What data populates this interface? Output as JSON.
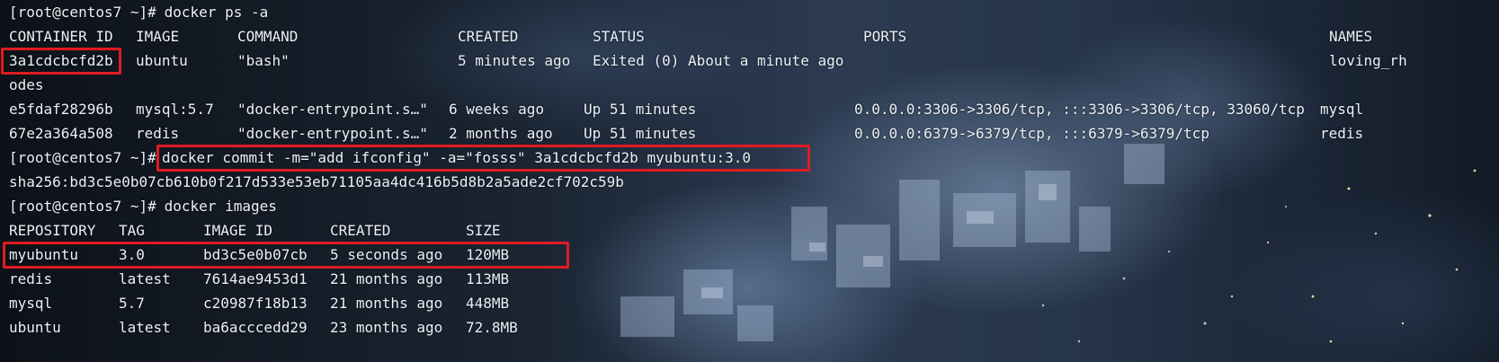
{
  "terminal": {
    "prompt": "[root@centos7 ~]#",
    "cmd1": " docker ps -a",
    "ps_headers": {
      "id": "CONTAINER ID",
      "image": "IMAGE",
      "command": "COMMAND",
      "created": "CREATED",
      "status": "STATUS",
      "ports": "PORTS",
      "names": "NAMES"
    },
    "ps_rows": [
      {
        "id": "3a1cdcbcfd2b",
        "image": "ubuntu",
        "command": "\"bash\"",
        "created": "5 minutes ago",
        "status": "Exited (0) About a minute ago",
        "ports": "",
        "names": "loving_rh",
        "wrap": "odes"
      },
      {
        "id": "e5fdaf28296b",
        "image": "mysql:5.7",
        "command": "\"docker-entrypoint.s…\"",
        "created": "6 weeks ago",
        "status": "Up 51 minutes",
        "ports": "0.0.0.0:3306->3306/tcp, :::3306->3306/tcp, 33060/tcp",
        "names": "mysql"
      },
      {
        "id": "67e2a364a508",
        "image": "redis",
        "command": "\"docker-entrypoint.s…\"",
        "created": "2 months ago",
        "status": "Up 51 minutes",
        "ports": "0.0.0.0:6379->6379/tcp, :::6379->6379/tcp",
        "names": "redis"
      }
    ],
    "cmd2": "docker commit -m=\"add ifconfig\" -a=\"fosss\" 3a1cdcbcfd2b myubuntu:3.0",
    "sha": "sha256:bd3c5e0b07cb610b0f217d533e53eb71105aa4dc416b5d8b2a5ade2cf702c59b",
    "cmd3": " docker images",
    "img_headers": {
      "repo": "REPOSITORY",
      "tag": "TAG",
      "id": "IMAGE ID",
      "created": "CREATED",
      "size": "SIZE"
    },
    "img_rows": [
      {
        "repo": "myubuntu",
        "tag": "3.0",
        "id": "bd3c5e0b07cb",
        "created": "5 seconds ago",
        "size": "120MB"
      },
      {
        "repo": "redis",
        "tag": "latest",
        "id": "7614ae9453d1",
        "created": "21 months ago",
        "size": "113MB"
      },
      {
        "repo": "mysql",
        "tag": "5.7",
        "id": "c20987f18b13",
        "created": "21 months ago",
        "size": "448MB"
      },
      {
        "repo": "ubuntu",
        "tag": "latest",
        "id": "ba6acccedd29",
        "created": "23 months ago",
        "size": "72.8MB"
      }
    ],
    "highlight_color": "#e11b22"
  }
}
